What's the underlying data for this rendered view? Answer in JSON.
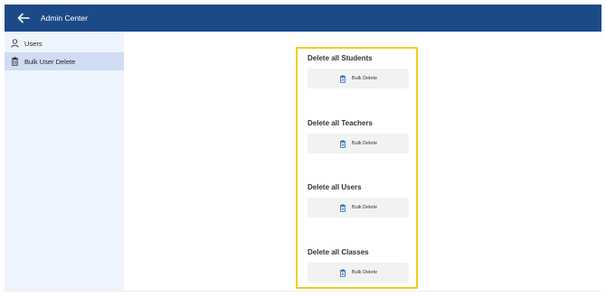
{
  "header": {
    "title": "Admin Center",
    "back_icon": "arrow-left-icon",
    "color": "#1c4a87"
  },
  "sidebar": {
    "items": [
      {
        "label": "Users",
        "icon": "user-icon",
        "active": false
      },
      {
        "label": "Bulk User Delete",
        "icon": "trash-icon",
        "active": true
      }
    ]
  },
  "main": {
    "panel_border_color": "#f2cc1f",
    "sections": [
      {
        "title": "Delete all Students",
        "button_label": "Bulk Delete",
        "icon": "trash-icon"
      },
      {
        "title": "Delete all Teachers",
        "button_label": "Bulk Delete",
        "icon": "trash-icon"
      },
      {
        "title": "Delete all Users",
        "button_label": "Bulk Delete",
        "icon": "trash-icon"
      },
      {
        "title": "Delete all Classes",
        "button_label": "Bulk Delete",
        "icon": "trash-icon"
      }
    ]
  }
}
